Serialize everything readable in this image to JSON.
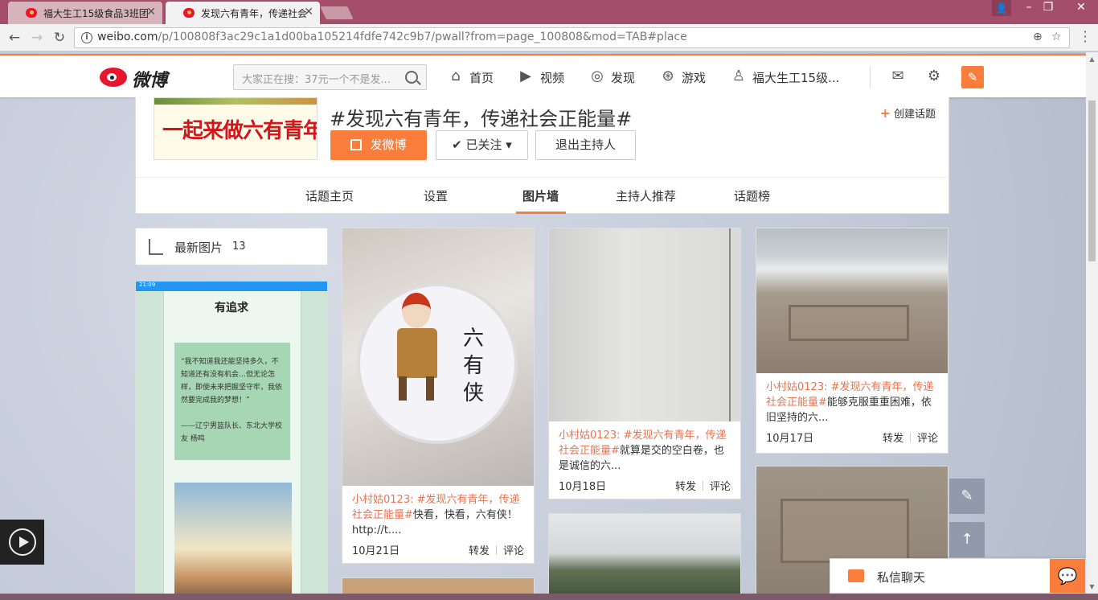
{
  "browser": {
    "tabs": [
      {
        "title": "福大生工15级食品3班团",
        "active": false
      },
      {
        "title": "发现六有青年，传递社会",
        "active": true
      }
    ],
    "url_prefix": "weibo.com",
    "url_rest": "/p/100808f3ac29c1a1d00ba105214fdfe742c9b7/pwall?from=page_100808&mod=TAB#place"
  },
  "weibo_nav": {
    "logo": "微博",
    "search_placeholder": "大家正在搜：37元一个不是发...",
    "links": {
      "home": "首页",
      "video": "视频",
      "discover": "发现",
      "game": "游戏",
      "user": "福大生工15级..."
    }
  },
  "topic": {
    "cover_slogan": "一起来做六有青年吧！",
    "title": "#发现六有青年，传递社会正能量#",
    "create_topic": "创建话题",
    "post_button": "发微博",
    "follow_button": "已关注",
    "quit_host_button": "退出主持人",
    "tabs": [
      "话题主页",
      "设置",
      "图片墙",
      "主持人推荐",
      "话题榜"
    ],
    "active_tab": "图片墙"
  },
  "sidebar": {
    "latest_label": "最新图片",
    "latest_count": "13",
    "phone": {
      "status_time": "21:09",
      "heading": "有追求",
      "quote": "“我不知道我还能坚持多久，不知道还有没有机会…但无论怎样，即使未来把握坚守牢，我依然要完成我的梦想！”",
      "author": "——辽宁男篮队长、东北大学校友 杨鸣"
    }
  },
  "cards": [
    {
      "user_tag": "小村姑0123: #发现六有青年，传递社会正能量#",
      "text": "快看，快看，六有侠！http://t....",
      "date": "10月21日",
      "repost": "转发",
      "comment": "评论",
      "badge_text": "六有侠"
    },
    {
      "user_tag": "小村姑0123: #发现六有青年，传递社会正能量#",
      "text": "就算是交的空白卷，也是诚信的六...",
      "date": "10月18日",
      "repost": "转发",
      "comment": "评论"
    },
    {
      "user_tag": "小村姑0123: #发现六有青年，传递社会正能量#",
      "text": "能够克服重重困难，依旧坚持的六...",
      "date": "10月17日",
      "repost": "转发",
      "comment": "评论"
    }
  ],
  "chat": {
    "label": "私信聊天"
  },
  "colors": {
    "accent": "#fa7d3c",
    "tag_link": "#eb7350",
    "tab_bar": "#a54e6b"
  }
}
